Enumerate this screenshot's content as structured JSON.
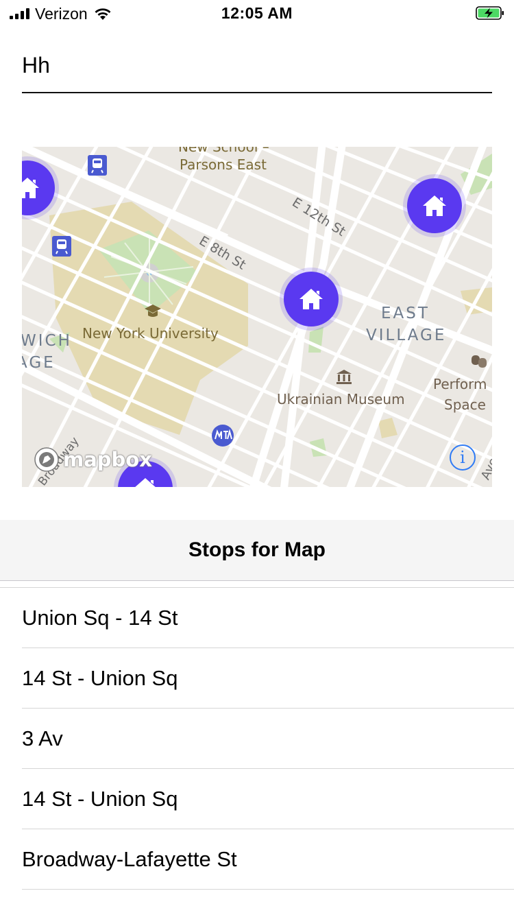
{
  "status_bar": {
    "carrier": "Verizon",
    "time": "12:05 AM",
    "battery_color": "#4cd964"
  },
  "search": {
    "value": "Hh"
  },
  "map": {
    "labels": {
      "new_school_line1": "New School –",
      "new_school_line2": "Parsons East",
      "e12": "E 12th St",
      "e8": "E 8th St",
      "nyu": "New York University",
      "east": "EAST",
      "village": "VILLAGE",
      "wich": "WICH",
      "age": "AGE",
      "ukrainian_museum": "Ukrainian Museum",
      "perform": "Perform",
      "space": "Space",
      "ave": "Ave",
      "broadway": "Broadway"
    },
    "poi_icons": [
      "train-icon",
      "university-icon",
      "museum-icon",
      "theater-icon",
      "mta-icon"
    ],
    "pin_color": "#5a39f0",
    "attribution": {
      "logo_text": "mapbox",
      "info_glyph": "i"
    }
  },
  "stops": {
    "title": "Stops for Map",
    "items": [
      "Union Sq - 14 St",
      "14 St - Union Sq",
      "3 Av",
      "14 St - Union Sq",
      "Broadway-Lafayette St"
    ]
  }
}
